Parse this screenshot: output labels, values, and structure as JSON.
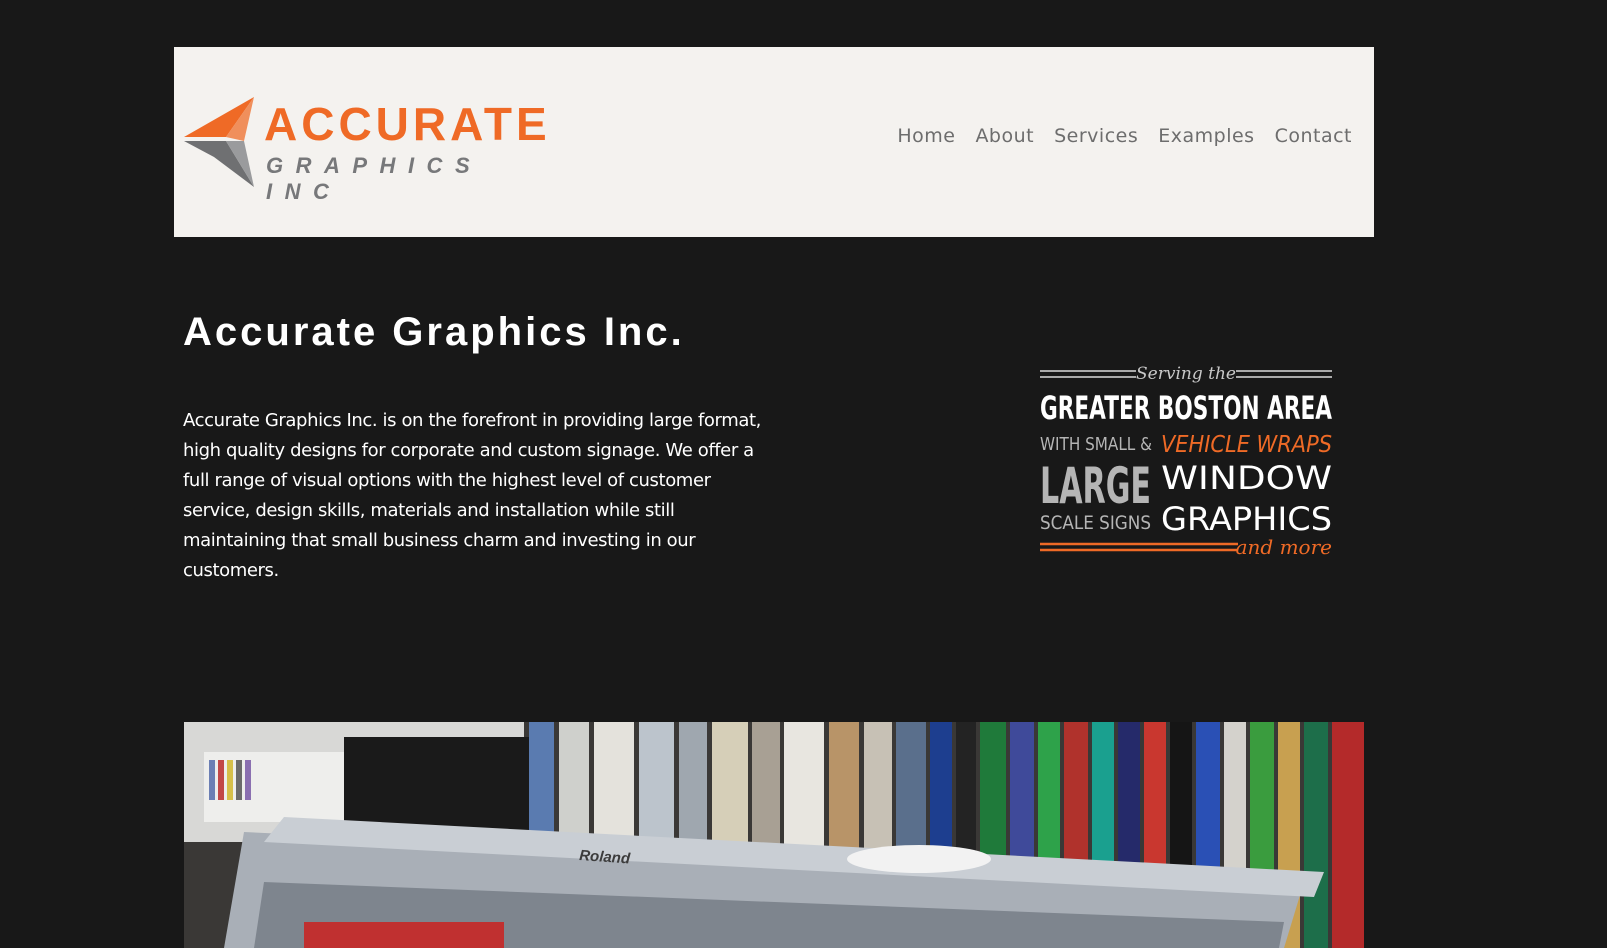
{
  "brand": {
    "logo_word": "ACCURATE",
    "logo_sub": "GRAPHICS INC",
    "accent_color": "#ef6a26",
    "secondary_color": "#77787a"
  },
  "nav": {
    "items": [
      "Home",
      "About",
      "Services",
      "Examples",
      "Contact"
    ]
  },
  "main": {
    "title": "Accurate Graphics Inc.",
    "intro": "Accurate Graphics Inc. is on the forefront in providing large format, high quality designs for corporate and custom signage. We offer a full range of visual options with the highest level of customer service, design skills, materials and installation while still maintaining that small business charm and investing in our customers."
  },
  "tagline": {
    "serving": "Serving the",
    "region": "GREATER BOSTON AREA",
    "with_small": "WITH SMALL &",
    "vehicle_wraps": "VEHICLE WRAPS",
    "large": "LARGE",
    "window": "WINDOW",
    "scale_signs": "SCALE SIGNS",
    "graphics": "GRAPHICS",
    "and_more": "and more"
  },
  "photo": {
    "machine_label": "Roland"
  }
}
